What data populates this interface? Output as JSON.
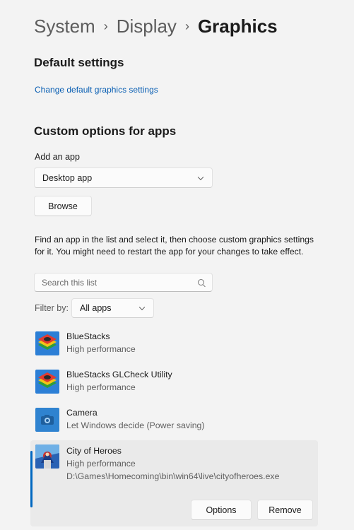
{
  "breadcrumb": {
    "level1": "System",
    "level2": "Display",
    "current": "Graphics",
    "separator": "›"
  },
  "default_settings": {
    "title": "Default settings",
    "link": "Change default graphics settings"
  },
  "custom": {
    "title": "Custom options for apps",
    "add_label": "Add an app",
    "app_type": "Desktop app",
    "browse_label": "Browse",
    "description": "Find an app in the list and select it, then choose custom graphics settings for it. You might need to restart the app for your changes to take effect.",
    "search_placeholder": "Search this list",
    "filter_label": "Filter by:",
    "filter_value": "All apps"
  },
  "apps": [
    {
      "name": "BlueStacks",
      "setting": "High performance",
      "icon": "bluestacks-icon"
    },
    {
      "name": "BlueStacks GLCheck Utility",
      "setting": "High performance",
      "icon": "bluestacks-icon"
    },
    {
      "name": "Camera",
      "setting": "Let Windows decide (Power saving)",
      "icon": "camera-icon"
    },
    {
      "name": "City of Heroes",
      "setting": "High performance",
      "path": "D:\\Games\\Homecoming\\bin\\win64\\live\\cityofheroes.exe",
      "icon": "city-of-heroes-icon",
      "options_label": "Options",
      "remove_label": "Remove"
    }
  ],
  "colors": {
    "accent": "#0067c0",
    "link": "#0a5fb3",
    "background": "#f3f3f3"
  }
}
